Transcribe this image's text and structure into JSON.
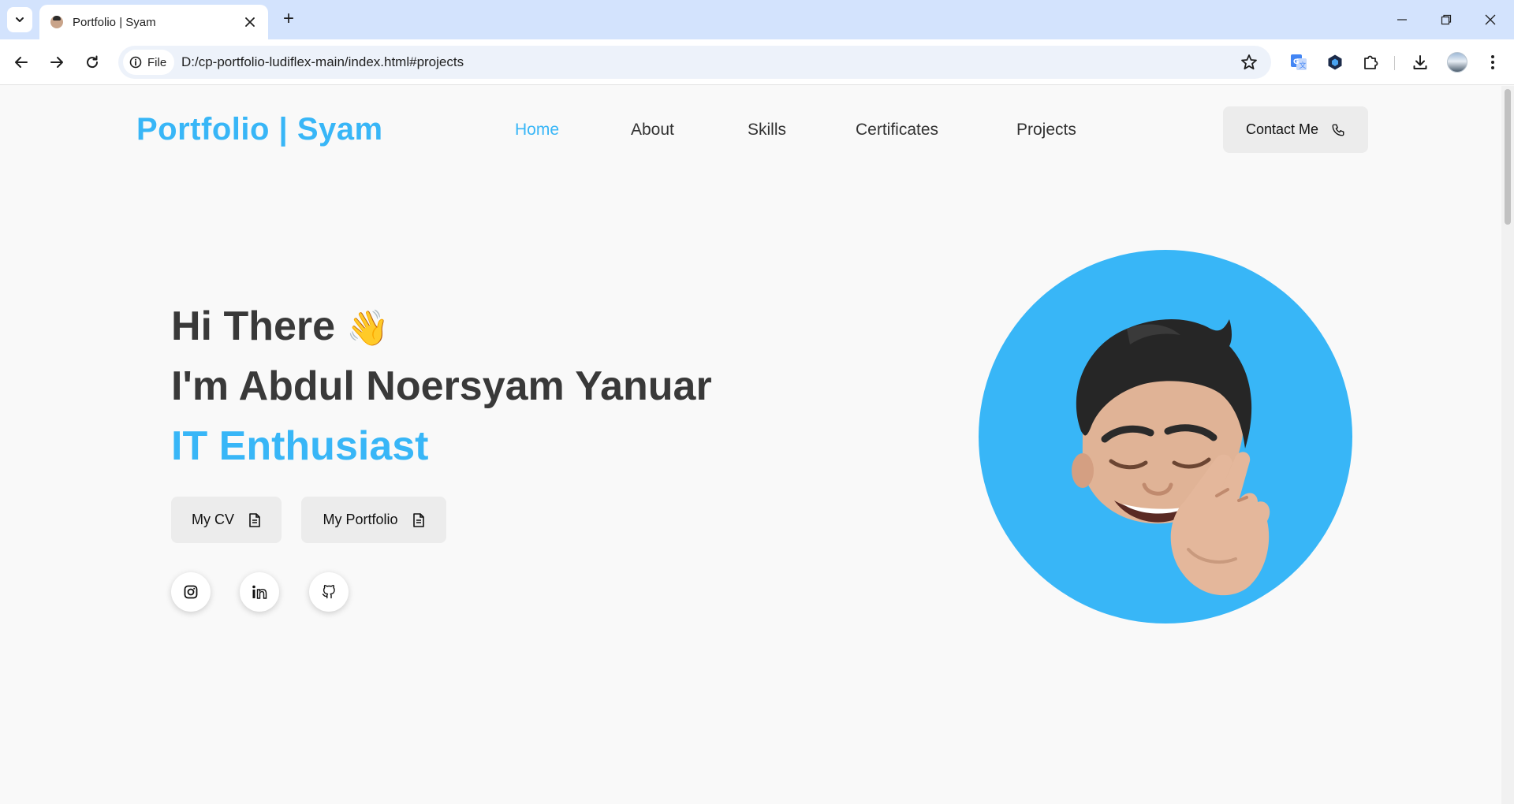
{
  "browser": {
    "tab_title": "Portfolio | Syam",
    "new_tab_symbol": "+",
    "address_chip": "File",
    "url": "D:/cp-portfolio-ludiflex-main/index.html#projects"
  },
  "site": {
    "logo": "Portfolio | Syam",
    "nav": [
      {
        "label": "Home",
        "active": true
      },
      {
        "label": "About",
        "active": false
      },
      {
        "label": "Skills",
        "active": false
      },
      {
        "label": "Certificates",
        "active": false
      },
      {
        "label": "Projects",
        "active": false
      }
    ],
    "contact_label": "Contact Me",
    "accent_color": "#38b6f7"
  },
  "hero": {
    "greeting": "Hi There",
    "wave_emoji": "👋",
    "name_line": "I'm Abdul Noersyam Yanuar",
    "role": "IT Enthusiast",
    "buttons": [
      {
        "label": "My CV",
        "icon": "document-icon"
      },
      {
        "label": "My Portfolio",
        "icon": "document-icon"
      }
    ],
    "social": [
      {
        "icon": "instagram-icon"
      },
      {
        "icon": "linkedin-icon"
      },
      {
        "icon": "github-icon"
      }
    ],
    "avatar": "memoji-avatar-fingers-crossed"
  }
}
